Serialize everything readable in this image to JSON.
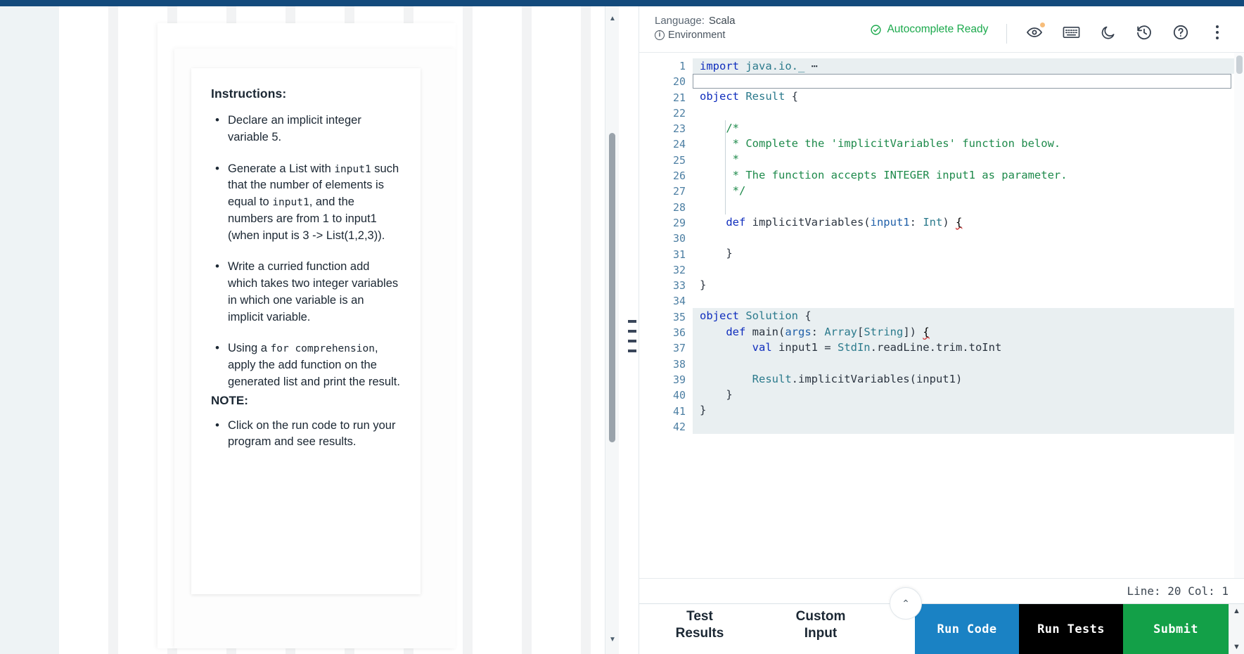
{
  "problem": {
    "instructions_title": "Instructions:",
    "bullets": [
      [
        {
          "t": "Declare an implicit integer variable 5.",
          "m": false
        }
      ],
      [
        {
          "t": "Generate a List with ",
          "m": false
        },
        {
          "t": "input1",
          "m": true
        },
        {
          "t": " such that the number of elements is equal to ",
          "m": false
        },
        {
          "t": "input1",
          "m": true
        },
        {
          "t": ", and the numbers are from 1 to input1 (when input is 3 -> List(1,2,3)).",
          "m": false
        }
      ],
      [
        {
          "t": "Write a curried function add which takes two integer variables in which one variable is an implicit variable.",
          "m": false
        }
      ],
      [
        {
          "t": "Using a ",
          "m": false
        },
        {
          "t": "for comprehension",
          "m": true
        },
        {
          "t": ", apply the add function on the generated list and print the result.",
          "m": false
        }
      ]
    ],
    "note_title": "NOTE:",
    "note_bullets": [
      [
        {
          "t": "Click on the run code to run your program and see results.",
          "m": false
        }
      ]
    ]
  },
  "editor_header": {
    "language_label": "Language:",
    "language_value": "Scala",
    "environment_label": "Environment",
    "autocomplete_status": "Autocomplete Ready",
    "icons": [
      {
        "name": "eye-icon",
        "title": "Preview"
      },
      {
        "name": "keyboard-icon",
        "title": "Keyboard shortcuts"
      },
      {
        "name": "moon-icon",
        "title": "Dark mode"
      },
      {
        "name": "history-icon",
        "title": "Restore"
      },
      {
        "name": "help-icon",
        "title": "Help"
      },
      {
        "name": "kebab-menu-icon",
        "title": "More"
      }
    ]
  },
  "code": {
    "lines": [
      {
        "num": "1",
        "fold": "›",
        "state": "locked",
        "tokens": [
          {
            "t": "import",
            "c": "kw"
          },
          {
            "t": " java.io._ ",
            "c": "typ"
          },
          {
            "t": "⋯",
            "c": "pln"
          }
        ]
      },
      {
        "num": "20",
        "fold": "",
        "state": "editing",
        "tokens": []
      },
      {
        "num": "21",
        "fold": "",
        "state": "plain",
        "tokens": [
          {
            "t": "object",
            "c": "kw"
          },
          {
            "t": " ",
            "c": "pln"
          },
          {
            "t": "Result",
            "c": "typ"
          },
          {
            "t": " {",
            "c": "pln"
          }
        ]
      },
      {
        "num": "22",
        "fold": "",
        "state": "plain",
        "tokens": []
      },
      {
        "num": "23",
        "fold": "",
        "state": "plain",
        "tokens": [
          {
            "t": "    /*",
            "c": "cmt"
          }
        ]
      },
      {
        "num": "24",
        "fold": "",
        "state": "plain",
        "tokens": [
          {
            "t": "     * Complete the 'implicitVariables' function below.",
            "c": "cmt"
          }
        ]
      },
      {
        "num": "25",
        "fold": "",
        "state": "plain",
        "tokens": [
          {
            "t": "     *",
            "c": "cmt"
          }
        ]
      },
      {
        "num": "26",
        "fold": "",
        "state": "plain",
        "tokens": [
          {
            "t": "     * The function accepts INTEGER input1 as parameter.",
            "c": "cmt"
          }
        ]
      },
      {
        "num": "27",
        "fold": "",
        "state": "plain",
        "tokens": [
          {
            "t": "     */",
            "c": "cmt"
          }
        ]
      },
      {
        "num": "28",
        "fold": "",
        "state": "plain",
        "tokens": []
      },
      {
        "num": "29",
        "fold": "",
        "state": "plain",
        "tokens": [
          {
            "t": "    ",
            "c": "pln"
          },
          {
            "t": "def",
            "c": "kw"
          },
          {
            "t": " implicitVariables(",
            "c": "pln"
          },
          {
            "t": "input1",
            "c": "blu"
          },
          {
            "t": ": ",
            "c": "pln"
          },
          {
            "t": "Int",
            "c": "typ"
          },
          {
            "t": ") ",
            "c": "pln"
          },
          {
            "t": "{",
            "c": "squig"
          }
        ]
      },
      {
        "num": "30",
        "fold": "",
        "state": "plain",
        "tokens": []
      },
      {
        "num": "31",
        "fold": "",
        "state": "plain",
        "tokens": [
          {
            "t": "    }",
            "c": "pln"
          }
        ]
      },
      {
        "num": "32",
        "fold": "",
        "state": "plain",
        "tokens": []
      },
      {
        "num": "33",
        "fold": "",
        "state": "plain",
        "tokens": [
          {
            "t": "}",
            "c": "pln"
          }
        ]
      },
      {
        "num": "34",
        "fold": "",
        "state": "plain",
        "tokens": []
      },
      {
        "num": "35",
        "fold": "⌄",
        "state": "locked",
        "tokens": [
          {
            "t": "object",
            "c": "kw"
          },
          {
            "t": " ",
            "c": "pln"
          },
          {
            "t": "Solution",
            "c": "typ"
          },
          {
            "t": " {",
            "c": "pln"
          }
        ]
      },
      {
        "num": "36",
        "fold": "",
        "state": "locked",
        "tokens": [
          {
            "t": "    ",
            "c": "pln"
          },
          {
            "t": "def",
            "c": "kw"
          },
          {
            "t": " main(",
            "c": "pln"
          },
          {
            "t": "args",
            "c": "blu"
          },
          {
            "t": ": ",
            "c": "pln"
          },
          {
            "t": "Array",
            "c": "typ"
          },
          {
            "t": "[",
            "c": "pln"
          },
          {
            "t": "String",
            "c": "typ"
          },
          {
            "t": "]) ",
            "c": "pln"
          },
          {
            "t": "{",
            "c": "squig"
          }
        ]
      },
      {
        "num": "37",
        "fold": "",
        "state": "locked",
        "tokens": [
          {
            "t": "        ",
            "c": "pln"
          },
          {
            "t": "val",
            "c": "kw"
          },
          {
            "t": " input1 = ",
            "c": "pln"
          },
          {
            "t": "StdIn",
            "c": "typ"
          },
          {
            "t": ".readLine.trim.toInt",
            "c": "pln"
          }
        ]
      },
      {
        "num": "38",
        "fold": "",
        "state": "locked",
        "tokens": []
      },
      {
        "num": "39",
        "fold": "",
        "state": "locked",
        "tokens": [
          {
            "t": "        ",
            "c": "pln"
          },
          {
            "t": "Result",
            "c": "typ"
          },
          {
            "t": ".implicitVariables(input1)",
            "c": "pln"
          }
        ]
      },
      {
        "num": "40",
        "fold": "",
        "state": "locked",
        "tokens": [
          {
            "t": "    }",
            "c": "pln"
          }
        ]
      },
      {
        "num": "41",
        "fold": "",
        "state": "locked",
        "tokens": [
          {
            "t": "}",
            "c": "pln"
          }
        ]
      },
      {
        "num": "42",
        "fold": "",
        "state": "locked",
        "tokens": []
      }
    ],
    "error_markers_at": [
      11,
      18
    ]
  },
  "status": {
    "cursor_text": "Line: 20 Col: 1"
  },
  "bottom": {
    "tabs": [
      {
        "name": "test-results-tab",
        "line1": "Test",
        "line2": "Results"
      },
      {
        "name": "custom-input-tab",
        "line1": "Custom",
        "line2": "Input"
      }
    ],
    "buttons": [
      {
        "name": "run-code-button",
        "label": "Run Code",
        "color": "#1a82c4"
      },
      {
        "name": "run-tests-button",
        "label": "Run Tests",
        "color": "#000000"
      },
      {
        "name": "submit-button",
        "label": "Submit",
        "color": "#13a048"
      }
    ],
    "collapse_icon": "⌃"
  },
  "colors": {
    "top_strip": "#134a7c",
    "accent_blue": "#1a82c4",
    "success_green": "#13a048",
    "status_green": "#1ba94c",
    "error_red": "#ef3b3b"
  }
}
